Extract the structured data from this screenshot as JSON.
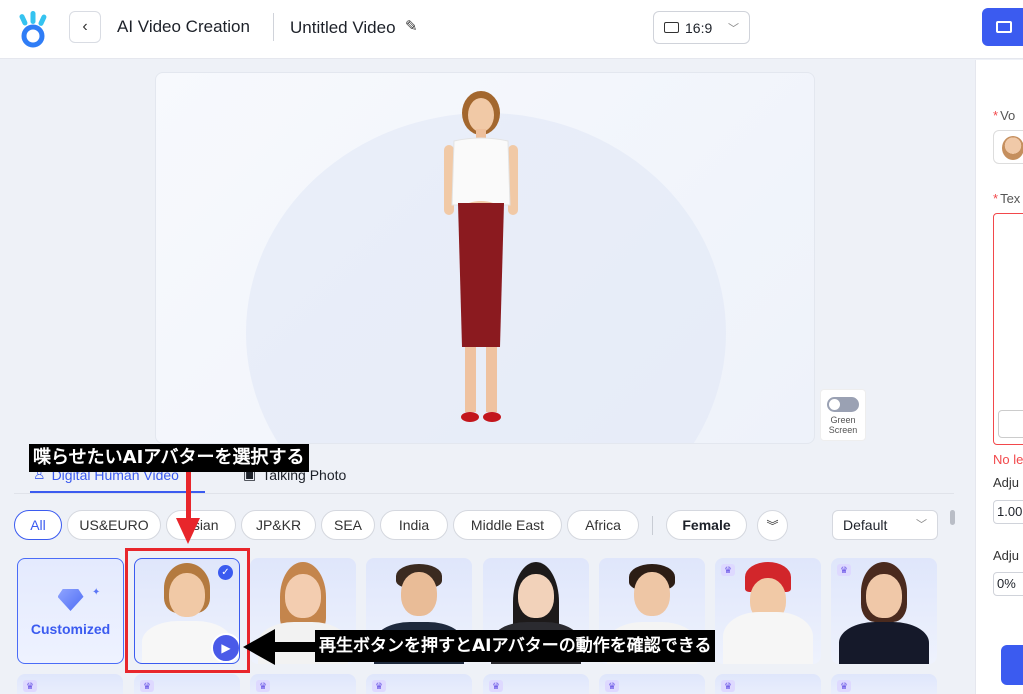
{
  "header": {
    "app_title": "AI Video Creation",
    "video_title": "Untitled Video",
    "aspect_ratio": "16:9",
    "accent_color": "#3b5bf0"
  },
  "preview": {
    "green_screen_label_1": "Green",
    "green_screen_label_2": "Screen",
    "green_screen_on": false
  },
  "tabs": [
    {
      "label": "Digital Human Video",
      "icon": "person-icon",
      "active": true
    },
    {
      "label": "Talking Photo",
      "icon": "image-icon",
      "active": false
    }
  ],
  "filters": {
    "regions": [
      "All",
      "US&EURO",
      "Asian",
      "JP&KR",
      "SEA",
      "India",
      "Middle East",
      "Africa"
    ],
    "active_region": "All",
    "gender": "Female",
    "sort": "Default"
  },
  "avatars": {
    "customized_label": "Customized",
    "selected_index": 0
  },
  "right_panel": {
    "voice_label": "Vo",
    "text_label": "Tex",
    "error_text": "No le",
    "adjust_label_1": "Adju",
    "adjust_value_1": "1.00",
    "adjust_label_2": "Adju",
    "adjust_value_2": "0%"
  },
  "annotations": {
    "select_avatar": "喋らせたいAIアバターを選択する",
    "play_preview": "再生ボタンを押すとAIアバターの動作を確認できる"
  }
}
